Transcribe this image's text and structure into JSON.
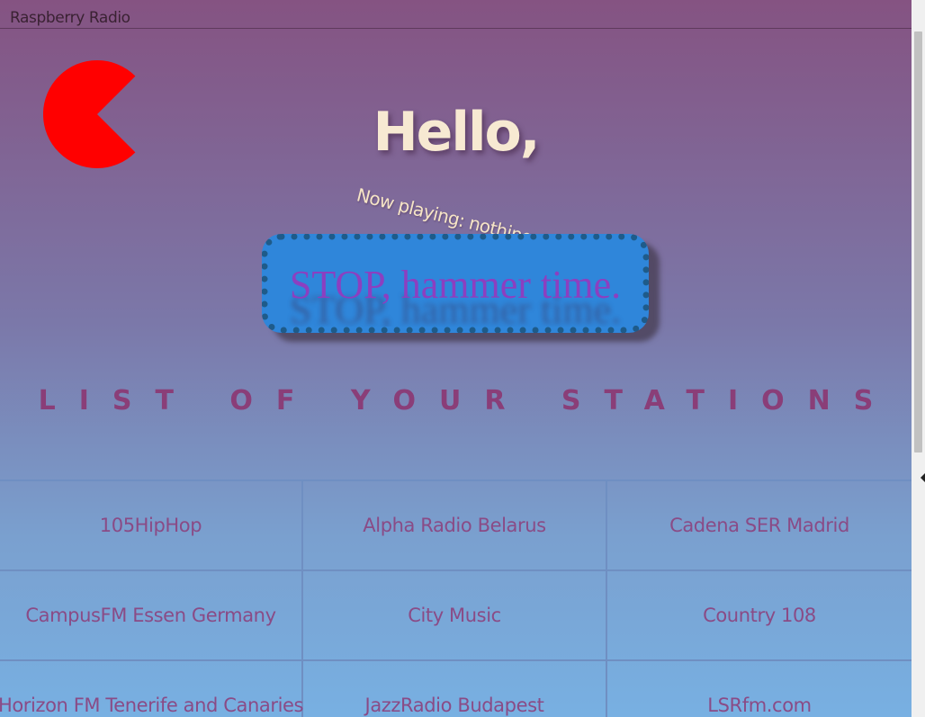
{
  "app": {
    "title": "Raspberry Radio"
  },
  "hero": {
    "greeting": "Hello,",
    "now_playing": "Now playing: nothing..."
  },
  "player": {
    "stop_label": "STOP, hammer time."
  },
  "stations": {
    "heading": "LIST OF YOUR STATIONS",
    "items": [
      {
        "label": "105HipHop"
      },
      {
        "label": "Alpha Radio Belarus"
      },
      {
        "label": "Cadena SER Madrid"
      },
      {
        "label": "CampusFM Essen Germany"
      },
      {
        "label": "City Music"
      },
      {
        "label": "Country 108"
      },
      {
        "label": "Horizon FM Tenerife and Canaries"
      },
      {
        "label": "JazzRadio Budapest"
      },
      {
        "label": "LSRfm.com"
      }
    ]
  },
  "icons": {
    "logo": "pacman-icon",
    "scroll": "chevron-left-icon"
  },
  "colors": {
    "logo": "#ff0000",
    "greeting": "#f7e9d2",
    "button_bg": "#2f86da",
    "button_text": "#8c3fc0",
    "heading": "#8a3e78",
    "station_text": "#8a4b86"
  }
}
